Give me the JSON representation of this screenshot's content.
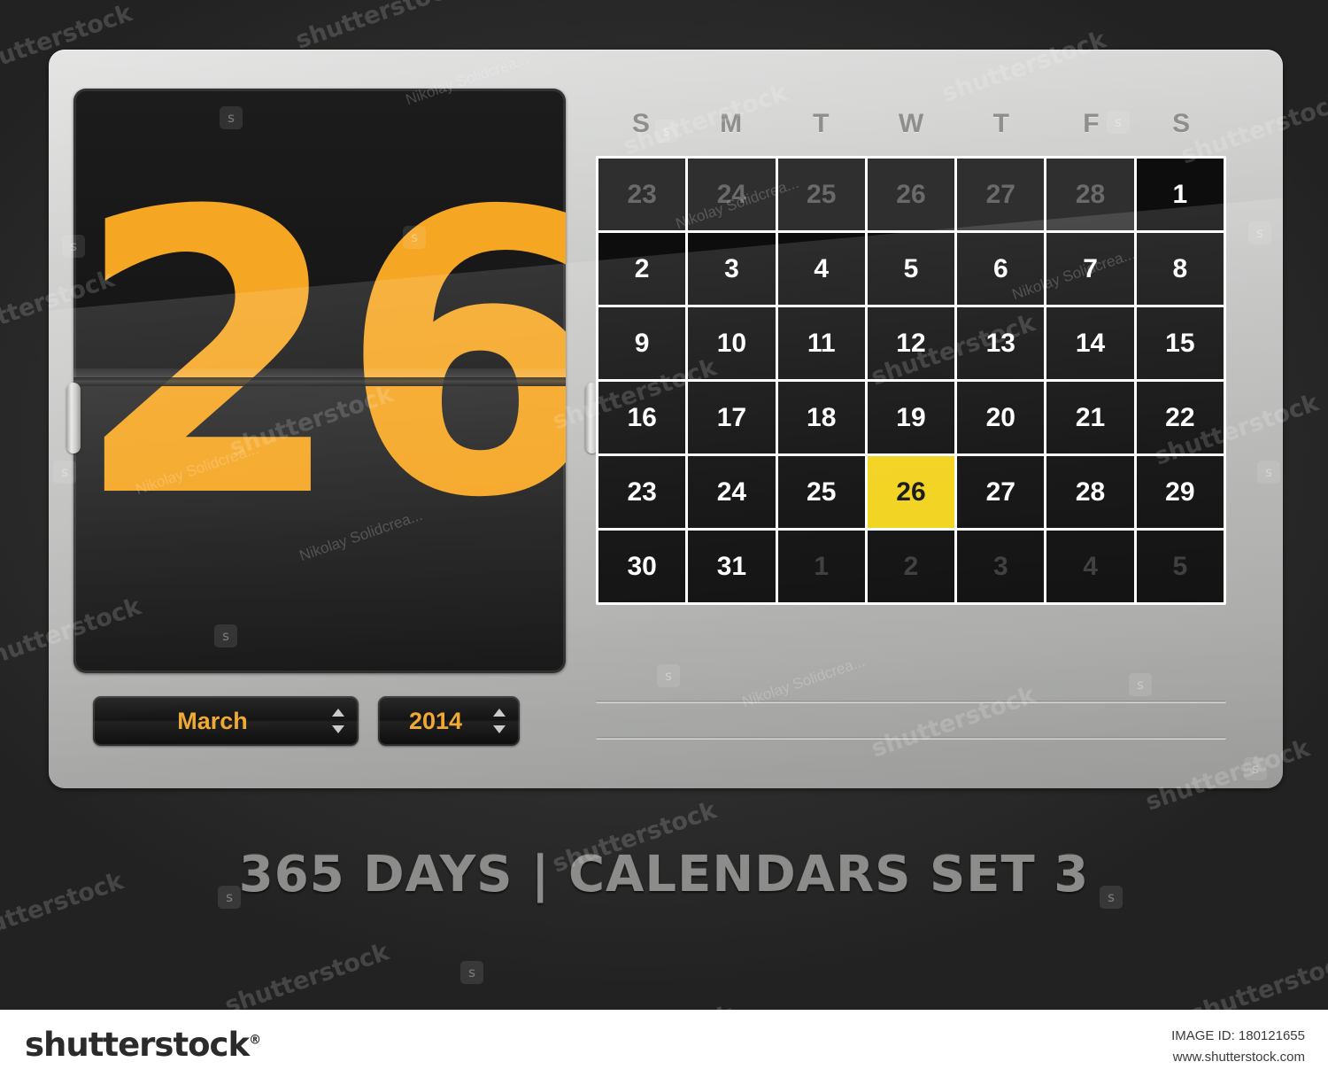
{
  "caption": "365 DAYS | CALENDARS SET 3",
  "flip": {
    "day_number": "26"
  },
  "selectors": {
    "month": "March",
    "year": "2014"
  },
  "calendar": {
    "weekdays": [
      "S",
      "M",
      "T",
      "W",
      "T",
      "F",
      "S"
    ],
    "today": "26",
    "highlight_color": "#f2d21a",
    "accent_color": "#f5a623",
    "cells": [
      {
        "label": "23",
        "state": "prev"
      },
      {
        "label": "24",
        "state": "prev"
      },
      {
        "label": "25",
        "state": "prev"
      },
      {
        "label": "26",
        "state": "prev"
      },
      {
        "label": "27",
        "state": "prev"
      },
      {
        "label": "28",
        "state": "prev"
      },
      {
        "label": "1",
        "state": "current"
      },
      {
        "label": "2",
        "state": "current"
      },
      {
        "label": "3",
        "state": "current"
      },
      {
        "label": "4",
        "state": "current"
      },
      {
        "label": "5",
        "state": "current"
      },
      {
        "label": "6",
        "state": "current"
      },
      {
        "label": "7",
        "state": "current"
      },
      {
        "label": "8",
        "state": "current"
      },
      {
        "label": "9",
        "state": "current"
      },
      {
        "label": "10",
        "state": "current"
      },
      {
        "label": "11",
        "state": "current"
      },
      {
        "label": "12",
        "state": "current"
      },
      {
        "label": "13",
        "state": "current"
      },
      {
        "label": "14",
        "state": "current"
      },
      {
        "label": "15",
        "state": "current"
      },
      {
        "label": "16",
        "state": "current"
      },
      {
        "label": "17",
        "state": "current"
      },
      {
        "label": "18",
        "state": "current"
      },
      {
        "label": "19",
        "state": "current"
      },
      {
        "label": "20",
        "state": "current"
      },
      {
        "label": "21",
        "state": "current"
      },
      {
        "label": "22",
        "state": "current"
      },
      {
        "label": "23",
        "state": "current"
      },
      {
        "label": "24",
        "state": "current"
      },
      {
        "label": "25",
        "state": "current"
      },
      {
        "label": "26",
        "state": "today"
      },
      {
        "label": "27",
        "state": "current"
      },
      {
        "label": "28",
        "state": "current"
      },
      {
        "label": "29",
        "state": "current"
      },
      {
        "label": "30",
        "state": "current"
      },
      {
        "label": "31",
        "state": "current"
      },
      {
        "label": "1",
        "state": "next"
      },
      {
        "label": "2",
        "state": "next"
      },
      {
        "label": "3",
        "state": "next"
      },
      {
        "label": "4",
        "state": "next"
      },
      {
        "label": "5",
        "state": "next"
      }
    ]
  },
  "footer": {
    "logo": "shutterstock",
    "logo_mark": "®",
    "image_id_label": "IMAGE ID: 180121655",
    "site": "www.shutterstock.com"
  },
  "watermarks": {
    "brand": "shutterstock",
    "author": "Nikolay Solidcrea...",
    "mark_glyph": "s"
  }
}
